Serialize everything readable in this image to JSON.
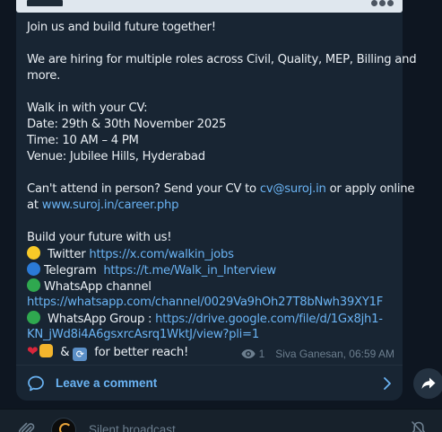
{
  "post": {
    "lines": [
      {
        "type": "text",
        "text": "Join us and build future together!"
      },
      {
        "type": "gap"
      },
      {
        "type": "text",
        "text": "We are hiring for multiple roles across Civil, Quality, MEP, Billing and"
      },
      {
        "type": "text",
        "text": "more."
      },
      {
        "type": "gap"
      },
      {
        "type": "text",
        "text": "Walk in with your CV:"
      },
      {
        "type": "text",
        "text": "Date: 29th & 30th November 2025"
      },
      {
        "type": "text",
        "text": "Time: 10 AM – 4 PM"
      },
      {
        "type": "text",
        "text": "Venue: Jubilee Hills, Hyderabad"
      }
    ],
    "cant_attend_prefix": "Can't attend in person? Send your CV to ",
    "cv_email": "cv@suroj.in",
    "cant_attend_suffix": " or apply online",
    "at_prefix": "at ",
    "career_url": "www.suroj.in/career.php",
    "build_future": "Build your future with us!",
    "twitter_label": " Twitter ",
    "twitter_url": "https://x.com/walkin_jobs",
    "telegram_label": "Telegram ",
    "telegram_url": "https://t.me/Walk_in_Interview",
    "whatsapp_channel_label": "WhatsApp channel",
    "whatsapp_channel_url": "https://whatsapp.com/channel/0029Va9hOh27T8bNwh39XY1F",
    "whatsapp_group_label": " WhatsApp Group : ",
    "whatsapp_group_url_1": "https://drive.google.com/file/d/1Gx8jh1-",
    "whatsapp_group_url_2": "KN_jWd8i4A6gsxrcAsrq1WktJ/view?pli=1",
    "reach_amp": " & ",
    "reach_suffix": " for better reach!",
    "emoji": {
      "yellow": "yellow-circle",
      "blue": "blue-circle",
      "green": "green-circle",
      "heart": "❤",
      "thumb": "thumbs-up",
      "refresh": "⟳"
    }
  },
  "meta": {
    "views": "1",
    "author_time": "Siva Ganesan, 06:59 AM"
  },
  "comments": {
    "label": "Leave a comment"
  },
  "composer": {
    "placeholder": "Silent broadcast"
  },
  "colors": {
    "background": "#0e1621",
    "bubble": "#182533",
    "link": "#6ab3f3",
    "meta": "#6d7f8f"
  }
}
